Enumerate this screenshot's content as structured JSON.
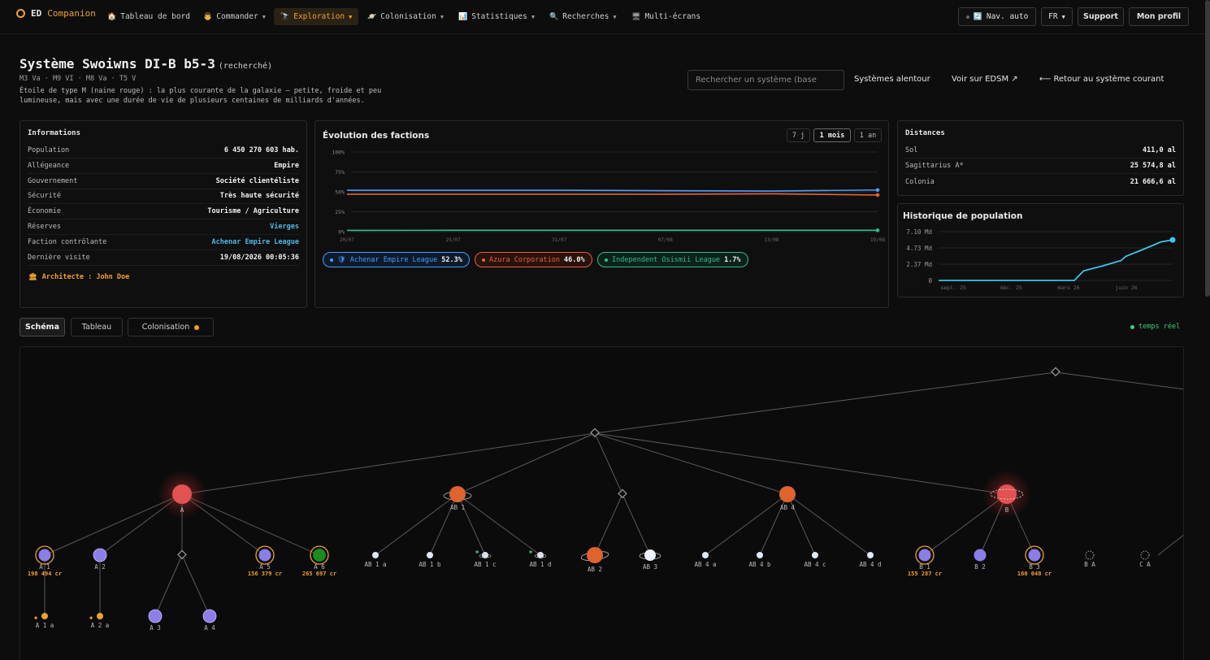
{
  "nav": {
    "brand_1": "ED",
    "brand_2": "Companion",
    "items": [
      {
        "label": "Tableau de bord",
        "icon": "🏠"
      },
      {
        "label": "Commander",
        "icon": "👨"
      },
      {
        "label": "Exploration",
        "icon": "🔭"
      },
      {
        "label": "Colonisation",
        "icon": "🪐"
      },
      {
        "label": "Statistiques",
        "icon": "📊"
      },
      {
        "label": "Recherches",
        "icon": "🔍"
      },
      {
        "label": "Multi-écrans",
        "icon": "🖥"
      }
    ],
    "nav_auto": "Nav. auto",
    "lang": "FR",
    "support": "Support",
    "profile": "Mon profil"
  },
  "header": {
    "title": "Système Swoiwns DI-B b5-3",
    "status": "(recherché)",
    "spectral": "M3 Va · M9 VI · M8 Va · T5 V",
    "description": "Étoile de type M (naine rouge) : la plus courante de la galaxie — petite, froide et peu lumineuse, mais avec une durée de vie de plusieurs centaines de milliards d'années.",
    "search_placeholder": "Rechercher un système (base",
    "nearby": "Systèmes alentour",
    "edsm": "Voir sur EDSM ↗",
    "back": "⟵ Retour au système courant"
  },
  "info": {
    "title": "Informations",
    "rows": [
      {
        "k": "Population",
        "v": "6 450 270 603 hab."
      },
      {
        "k": "Allégeance",
        "v": "Empire"
      },
      {
        "k": "Gouvernement",
        "v": "Société clientéliste"
      },
      {
        "k": "Sécurité",
        "v": "Très haute sécurité"
      },
      {
        "k": "Économie",
        "v": "Tourisme / Agriculture"
      },
      {
        "k": "Réserves",
        "v": "Vierges"
      },
      {
        "k": "Faction contrôlante",
        "v": "Achenar Empire League"
      },
      {
        "k": "Dernière visite",
        "v": "19/08/2026 00:05:36"
      }
    ],
    "architect": "Architecte : John Doe"
  },
  "factions": {
    "title": "Évolution des factions",
    "ranges": [
      "7 j",
      "1 mois",
      "1 an"
    ],
    "legend": [
      {
        "name": "Achenar Empire League",
        "pct": "52.3%",
        "color": "#4a9eff"
      },
      {
        "name": "Azura Corporation",
        "pct": "46.0%",
        "color": "#e8623a"
      },
      {
        "name": "Independent Osismii League",
        "pct": "1.7%",
        "color": "#2fbf8a"
      }
    ]
  },
  "distances": {
    "title": "Distances",
    "rows": [
      {
        "k": "Sol",
        "v": "411,0 al"
      },
      {
        "k": "Sagittarius A*",
        "v": "25 574,8 al"
      },
      {
        "k": "Colonia",
        "v": "21 666,6 al"
      }
    ]
  },
  "population_history": {
    "title": "Historique de population"
  },
  "tabs": [
    "Schéma",
    "Tableau",
    "Colonisation"
  ],
  "live": "temps réel",
  "chart_data": [
    {
      "type": "line",
      "title": "Évolution des factions",
      "x": [
        "20/07",
        "25/07",
        "31/07",
        "07/08",
        "13/08",
        "19/08"
      ],
      "y_ticks": [
        "100%",
        "75%",
        "50%",
        "25%",
        "0%"
      ],
      "ylim": [
        0,
        100
      ],
      "series": [
        {
          "name": "Achenar Empire League",
          "color": "#4a9eff",
          "values": [
            52,
            52,
            52,
            51.5,
            51,
            52.3
          ]
        },
        {
          "name": "Azura Corporation",
          "color": "#e8623a",
          "values": [
            47,
            47,
            47,
            47,
            47.5,
            46.0
          ]
        },
        {
          "name": "Independent Osismii League",
          "color": "#2fbf8a",
          "values": [
            1.6,
            1.7,
            1.7,
            1.7,
            1.7,
            1.7
          ]
        }
      ]
    },
    {
      "type": "line",
      "title": "Historique de population",
      "x_ticks": [
        "sept. 25",
        "déc. 25",
        "mars 26",
        "juin 26"
      ],
      "y_ticks": [
        "7.10 Md",
        "4.73 Md",
        "2.37 Md",
        "0"
      ],
      "ylim": [
        0,
        7.1
      ],
      "series": [
        {
          "color": "#3fc4e8",
          "points": [
            [
              0,
              0
            ],
            [
              0.58,
              0
            ],
            [
              0.62,
              1.4
            ],
            [
              0.7,
              2.1
            ],
            [
              0.78,
              2.9
            ],
            [
              0.8,
              3.5
            ],
            [
              0.88,
              4.6
            ],
            [
              0.95,
              5.6
            ],
            [
              1,
              5.9
            ]
          ]
        }
      ]
    }
  ],
  "bodies": [
    {
      "label": "A",
      "kind": "star-red"
    },
    {
      "label": "AB 1",
      "kind": "ringed-orange"
    },
    {
      "label": "AB 4",
      "kind": "orange"
    },
    {
      "label": "B",
      "kind": "star-red"
    },
    {
      "label": "A 1",
      "kind": "purple-ring",
      "price": "198 494 cr"
    },
    {
      "label": "A 2",
      "kind": "purple"
    },
    {
      "label": "A 5",
      "kind": "purple-ring",
      "price": "156 379 cr"
    },
    {
      "label": "A 6",
      "kind": "green-ring",
      "price": "265 697 cr"
    },
    {
      "label": "AB 1 a",
      "kind": "small"
    },
    {
      "label": "AB 1 b",
      "kind": "small"
    },
    {
      "label": "AB 1 c",
      "kind": "small-green"
    },
    {
      "label": "AB 1 d",
      "kind": "small-green"
    },
    {
      "label": "AB 2",
      "kind": "ringed-orange-big"
    },
    {
      "label": "AB 3",
      "kind": "ringed-white"
    },
    {
      "label": "AB 4 a",
      "kind": "small"
    },
    {
      "label": "AB 4 b",
      "kind": "small"
    },
    {
      "label": "AB 4 c",
      "kind": "small"
    },
    {
      "label": "AB 4 d",
      "kind": "small"
    },
    {
      "label": "B 1",
      "kind": "purple-ring",
      "price": "155 287 cr"
    },
    {
      "label": "B 2",
      "kind": "purple"
    },
    {
      "label": "B 3",
      "kind": "purple-ring",
      "price": "160 048 cr"
    },
    {
      "label": "B A",
      "kind": "dashed"
    },
    {
      "label": "C A",
      "kind": "dashed"
    },
    {
      "label": "A 1 a",
      "kind": "tiny-orange"
    },
    {
      "label": "A 2 a",
      "kind": "tiny-orange"
    },
    {
      "label": "A 3",
      "kind": "purple"
    },
    {
      "label": "A 4",
      "kind": "purple"
    }
  ]
}
